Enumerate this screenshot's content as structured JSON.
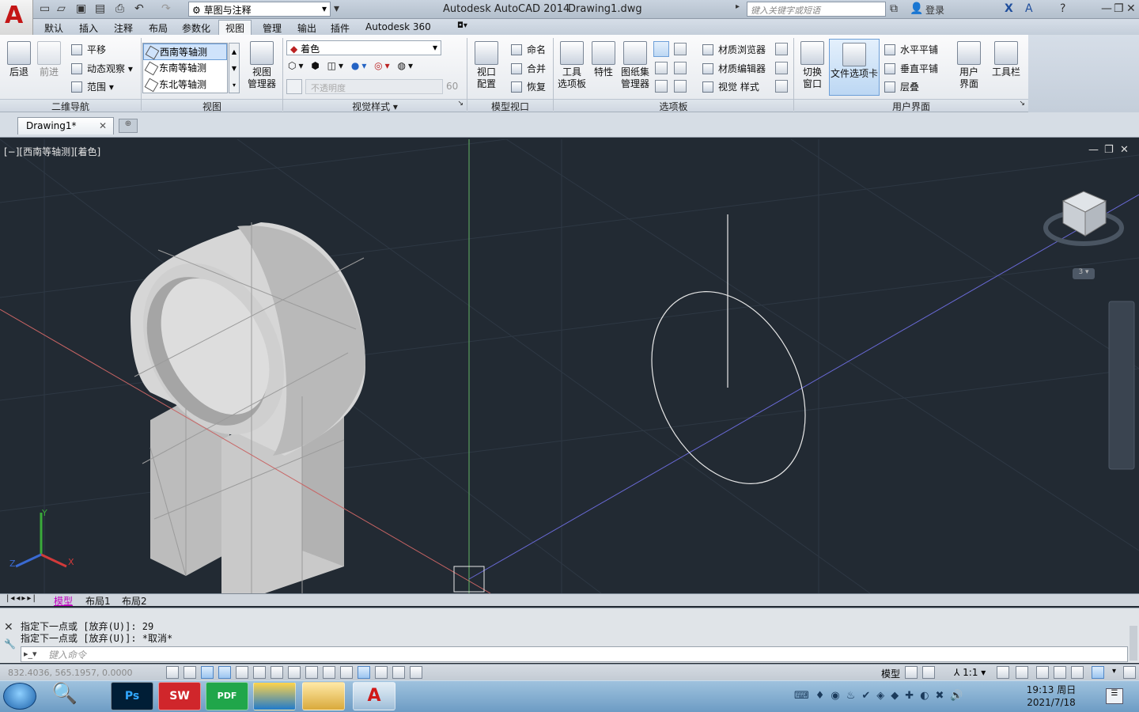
{
  "titlebar": {
    "workspace": "草图与注释",
    "title": "Autodesk AutoCAD 2014",
    "file": "Drawing1.dwg",
    "search_placeholder": "键入关键字或短语",
    "login": "登录"
  },
  "menu_tabs": [
    "默认",
    "插入",
    "注释",
    "布局",
    "参数化",
    "视图",
    "管理",
    "输出",
    "插件",
    "Autodesk 360"
  ],
  "active_tab": "视图",
  "ribbon": {
    "nav": {
      "back": "后退",
      "forward": "前进",
      "pan": "平移",
      "orbit": "动态观察",
      "extents": "范围",
      "title": "二维导航"
    },
    "views": {
      "items": [
        "西南等轴测",
        "东南等轴测",
        "东北等轴测"
      ],
      "selected": "西南等轴测",
      "manager": "视图\n管理器",
      "title": "视图"
    },
    "visual_styles": {
      "current": "着色",
      "opacity_label": "不透明度",
      "opacity_value": "60",
      "title": "视觉样式"
    },
    "model_viewports": {
      "config": "视口\n配置",
      "named": "命名",
      "join": "合并",
      "restore": "恢复",
      "title": "模型视口"
    },
    "palettes": {
      "tool": "工具\n选项板",
      "properties": "特性",
      "sheetset": "图纸集\n管理器",
      "mat_browser": "材质浏览器",
      "mat_editor": "材质编辑器",
      "visual_styles": "视觉 样式",
      "title": "选项板"
    },
    "ui": {
      "switch": "切换\n窗口",
      "file_tabs": "文件选项卡",
      "tile_h": "水平平铺",
      "tile_v": "垂直平铺",
      "cascade": "层叠",
      "user_iface": "用户\n界面",
      "toolbars": "工具栏",
      "title": "用户界面"
    }
  },
  "doc_tabs": [
    {
      "label": "Drawing1*"
    }
  ],
  "viewport": {
    "label": "[−][西南等轴测][着色]",
    "nav_label": "3"
  },
  "layout_tabs": [
    "模型",
    "布局1",
    "布局2"
  ],
  "active_layout": "模型",
  "command": {
    "history": [
      "指定下一点或 [放弃(U)]: 29",
      "指定下一点或 [放弃(U)]: *取消*"
    ],
    "placeholder": "键入命令"
  },
  "status": {
    "coords": "832.4036, 565.1957, 0.0000",
    "model": "模型",
    "scale": "1:1"
  },
  "taskbar": {
    "apps": [
      "Ps",
      "SW",
      "PDF",
      "",
      "",
      "A"
    ],
    "time": "19:13 周日",
    "date": "2021/7/18"
  }
}
